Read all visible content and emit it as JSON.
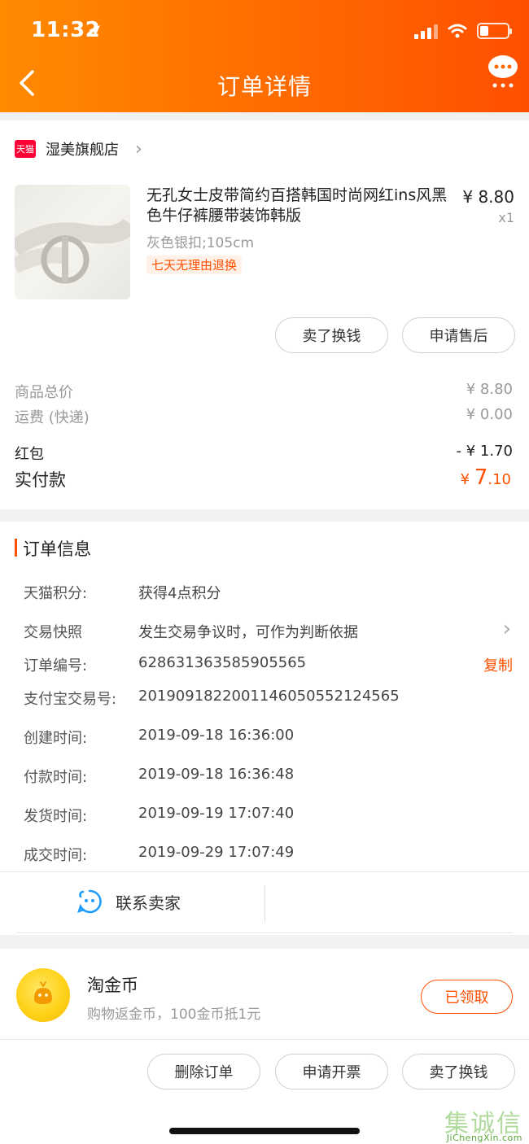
{
  "status_bar": {
    "time": "11:32",
    "battery_level": 0.3
  },
  "nav": {
    "title": "订单详情",
    "back_icon": "chevron-left-icon",
    "chat_icon": "chat-bubble-icon"
  },
  "store": {
    "badge": "天猫",
    "name": "湿美旗舰店"
  },
  "product": {
    "title": "无孔女士皮带简约百搭韩国时尚网红ins风黑色牛仔裤腰带装饰韩版",
    "spec": "灰色银扣;105cm",
    "tag": "七天无理由退换",
    "price": "¥ 8.80",
    "qty": "x1"
  },
  "item_actions": {
    "sell": "卖了换钱",
    "after_sale": "申请售后"
  },
  "fees": {
    "goods_total_label": "商品总价",
    "goods_total_value": "¥ 8.80",
    "shipping_label": "运费 (快递)",
    "shipping_value": "¥ 0.00",
    "redpacket_label": "红包",
    "redpacket_value": "- ¥ 1.70",
    "paid_label": "实付款",
    "paid_currency": "¥",
    "paid_int": "7",
    "paid_dec": ".10"
  },
  "order_info": {
    "title": "订单信息",
    "rows": [
      {
        "label": "天猫积分:",
        "value": "获得4点积分"
      },
      {
        "label": "交易快照",
        "value": "发生交易争议时，可作为判断依据"
      },
      {
        "label": "订单编号:",
        "value": "628631363585905565"
      },
      {
        "label": "支付宝交易号:",
        "value": "2019091822001146050552124565"
      },
      {
        "label": "创建时间:",
        "value": "2019-09-18 16:36:00"
      },
      {
        "label": "付款时间:",
        "value": "2019-09-18 16:36:48"
      },
      {
        "label": "发货时间:",
        "value": "2019-09-19 17:07:40"
      },
      {
        "label": "成交时间:",
        "value": "2019-09-29 17:07:49"
      }
    ],
    "copy_label": "复制"
  },
  "contact": {
    "label": "联系卖家"
  },
  "coins": {
    "title": "淘金币",
    "subtitle": "购物返金币，100金币抵1元",
    "button": "已领取"
  },
  "bottom_actions": {
    "delete": "删除订单",
    "invoice": "申请开票",
    "sell": "卖了换钱"
  },
  "watermark": {
    "text": "JiChengXin.com",
    "brand": "集诚信"
  },
  "colors": {
    "accent": "#ff5000",
    "header_start": "#ff8a00",
    "header_end": "#ff4f00",
    "tmall_red": "#ff0036"
  }
}
